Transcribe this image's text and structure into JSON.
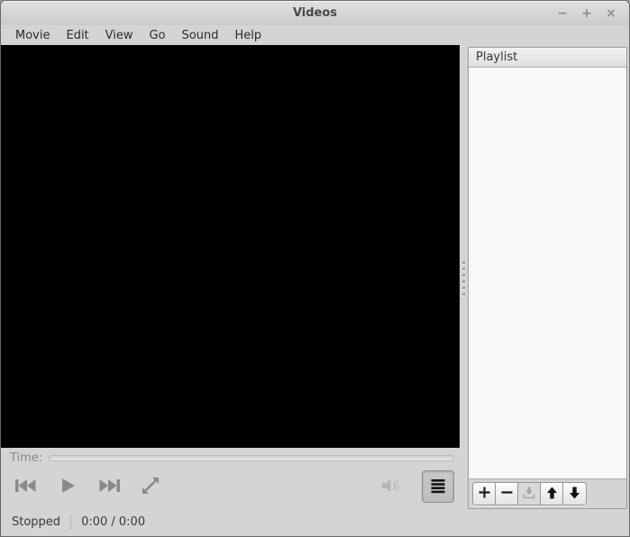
{
  "window": {
    "title": "Videos",
    "controls": {
      "minimize": {
        "glyph": "−",
        "name": "minimize"
      },
      "maximize": {
        "glyph": "+",
        "name": "maximize"
      },
      "close": {
        "glyph": "×",
        "name": "close"
      }
    }
  },
  "menu": {
    "items": [
      "Movie",
      "Edit",
      "View",
      "Go",
      "Sound",
      "Help"
    ]
  },
  "video": {
    "state": "no media loaded",
    "background": "#000000"
  },
  "controls": {
    "time_label": "Time:",
    "seek_value": 0,
    "seek_enabled": false,
    "buttons": [
      "previous",
      "play",
      "next",
      "fullscreen"
    ],
    "volume_enabled": false,
    "sidebar_toggle_pressed": true
  },
  "playlist": {
    "title": "Playlist",
    "items": [],
    "toolbar_icons": [
      "add-icon",
      "remove-icon",
      "save-playlist-icon",
      "move-up-icon",
      "move-down-icon"
    ],
    "save_enabled": false
  },
  "statusbar": {
    "state": "Stopped",
    "time": "0:00 / 0:00"
  },
  "icons": {
    "previous": "media-skip-backward",
    "play": "media-play",
    "next": "media-skip-forward",
    "fullscreen": "view-fullscreen",
    "volume": "audio-volume",
    "sidebar_toggle": "view-sidebar-lines"
  },
  "colors": {
    "window_bg": "#d6d4d2",
    "titlebar_top": "#e0e0e0",
    "titlebar_bottom": "#cbcbcb",
    "video_bg": "#000000",
    "playlist_bg": "#f8f8f8",
    "icon_gray": "#8a8a8a",
    "disabled_icon": "#b4b4b4",
    "text": "#2b2b2b"
  }
}
